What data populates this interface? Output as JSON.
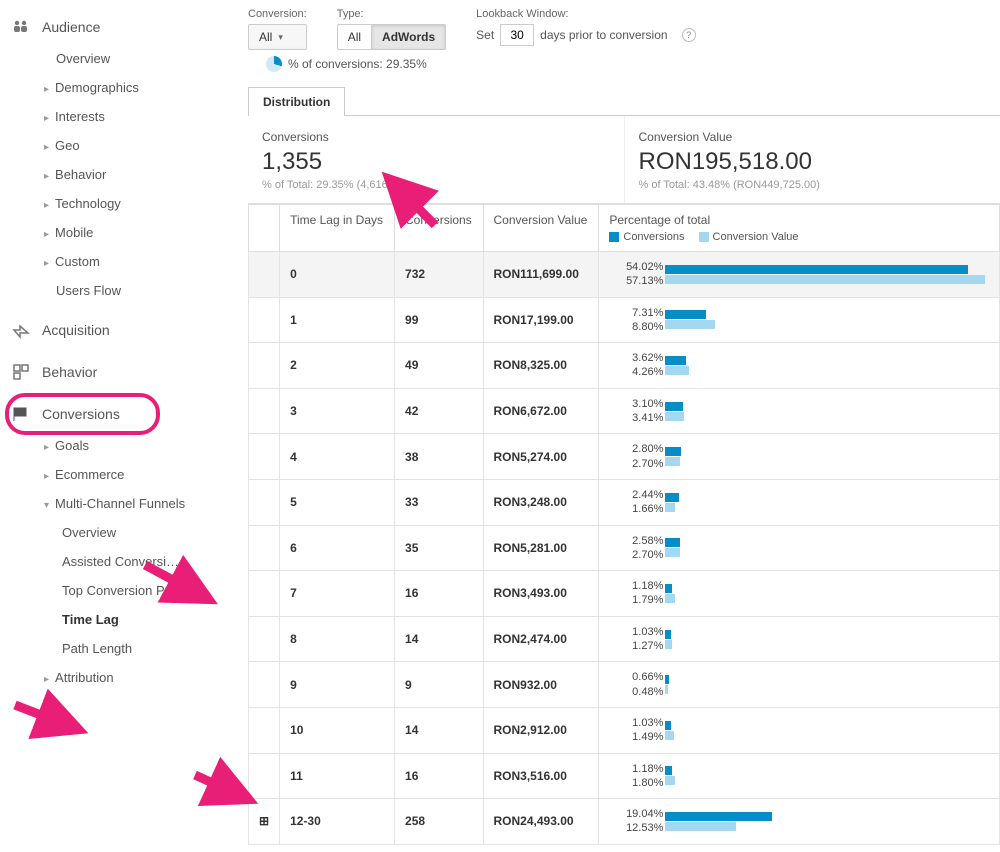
{
  "sidebar": {
    "audience": {
      "label": "Audience",
      "items": [
        {
          "label": "Overview",
          "arrow": false
        },
        {
          "label": "Demographics",
          "arrow": true
        },
        {
          "label": "Interests",
          "arrow": true
        },
        {
          "label": "Geo",
          "arrow": true
        },
        {
          "label": "Behavior",
          "arrow": true
        },
        {
          "label": "Technology",
          "arrow": true
        },
        {
          "label": "Mobile",
          "arrow": true
        },
        {
          "label": "Custom",
          "arrow": true
        },
        {
          "label": "Users Flow",
          "arrow": false
        }
      ]
    },
    "acquisition": {
      "label": "Acquisition"
    },
    "behavior": {
      "label": "Behavior"
    },
    "conversions": {
      "label": "Conversions",
      "items": [
        {
          "label": "Goals",
          "arrow": true
        },
        {
          "label": "Ecommerce",
          "arrow": true
        },
        {
          "label": "Multi-Channel Funnels",
          "arrow": true,
          "expanded": true,
          "children": [
            {
              "label": "Overview"
            },
            {
              "label": "Assisted Conversi…"
            },
            {
              "label": "Top Conversion P…"
            },
            {
              "label": "Time Lag",
              "bold": true
            },
            {
              "label": "Path Length"
            }
          ]
        },
        {
          "label": "Attribution",
          "arrow": true
        }
      ]
    }
  },
  "controls": {
    "conversion_label": "Conversion:",
    "conversion_value": "All",
    "type_label": "Type:",
    "type_all": "All",
    "type_adwords": "AdWords",
    "lookback_label": "Lookback Window:",
    "lookback_set": "Set",
    "lookback_days": "30",
    "lookback_suffix": "days prior to conversion",
    "pct_line": "% of conversions: 29.35%"
  },
  "tab": "Distribution",
  "summary": {
    "conv_label": "Conversions",
    "conv_value": "1,355",
    "conv_sub": "% of Total: 29.35% (4,616)",
    "val_label": "Conversion Value",
    "val_value": "RON195,518.00",
    "val_sub": "% of Total: 43.48% (RON449,725.00)"
  },
  "table": {
    "headers": {
      "time_lag": "Time Lag in Days",
      "conversions": "Conversions",
      "conv_value": "Conversion Value",
      "pct_total": "Percentage of total",
      "legend_conv": "Conversions",
      "legend_val": "Conversion Value"
    },
    "rows": [
      {
        "lag": "0",
        "conv": "732",
        "val": "RON111,699.00",
        "p1": "54.02%",
        "p2": "57.13%",
        "w1": 54.02,
        "w2": 57.13,
        "hl": true
      },
      {
        "lag": "1",
        "conv": "99",
        "val": "RON17,199.00",
        "p1": "7.31%",
        "p2": "8.80%",
        "w1": 7.31,
        "w2": 8.8
      },
      {
        "lag": "2",
        "conv": "49",
        "val": "RON8,325.00",
        "p1": "3.62%",
        "p2": "4.26%",
        "w1": 3.62,
        "w2": 4.26
      },
      {
        "lag": "3",
        "conv": "42",
        "val": "RON6,672.00",
        "p1": "3.10%",
        "p2": "3.41%",
        "w1": 3.1,
        "w2": 3.41
      },
      {
        "lag": "4",
        "conv": "38",
        "val": "RON5,274.00",
        "p1": "2.80%",
        "p2": "2.70%",
        "w1": 2.8,
        "w2": 2.7
      },
      {
        "lag": "5",
        "conv": "33",
        "val": "RON3,248.00",
        "p1": "2.44%",
        "p2": "1.66%",
        "w1": 2.44,
        "w2": 1.66
      },
      {
        "lag": "6",
        "conv": "35",
        "val": "RON5,281.00",
        "p1": "2.58%",
        "p2": "2.70%",
        "w1": 2.58,
        "w2": 2.7
      },
      {
        "lag": "7",
        "conv": "16",
        "val": "RON3,493.00",
        "p1": "1.18%",
        "p2": "1.79%",
        "w1": 1.18,
        "w2": 1.79
      },
      {
        "lag": "8",
        "conv": "14",
        "val": "RON2,474.00",
        "p1": "1.03%",
        "p2": "1.27%",
        "w1": 1.03,
        "w2": 1.27
      },
      {
        "lag": "9",
        "conv": "9",
        "val": "RON932.00",
        "p1": "0.66%",
        "p2": "0.48%",
        "w1": 0.66,
        "w2": 0.48
      },
      {
        "lag": "10",
        "conv": "14",
        "val": "RON2,912.00",
        "p1": "1.03%",
        "p2": "1.49%",
        "w1": 1.03,
        "w2": 1.49
      },
      {
        "lag": "11",
        "conv": "16",
        "val": "RON3,516.00",
        "p1": "1.18%",
        "p2": "1.80%",
        "w1": 1.18,
        "w2": 1.8
      },
      {
        "lag": "12-30",
        "conv": "258",
        "val": "RON24,493.00",
        "p1": "19.04%",
        "p2": "12.53%",
        "w1": 19.04,
        "w2": 12.53,
        "expand": true
      }
    ]
  },
  "chart_data": {
    "type": "bar",
    "title": "Time Lag — Percentage of total",
    "categories": [
      "0",
      "1",
      "2",
      "3",
      "4",
      "5",
      "6",
      "7",
      "8",
      "9",
      "10",
      "11",
      "12-30"
    ],
    "series": [
      {
        "name": "Conversions",
        "values": [
          54.02,
          7.31,
          3.62,
          3.1,
          2.8,
          2.44,
          2.58,
          1.18,
          1.03,
          0.66,
          1.03,
          1.18,
          19.04
        ]
      },
      {
        "name": "Conversion Value",
        "values": [
          57.13,
          8.8,
          4.26,
          3.41,
          2.7,
          1.66,
          2.7,
          1.79,
          1.27,
          0.48,
          1.49,
          1.8,
          12.53
        ]
      }
    ],
    "xlabel": "Time Lag in Days",
    "ylabel": "Percentage of total",
    "ylim": [
      0,
      60
    ]
  }
}
